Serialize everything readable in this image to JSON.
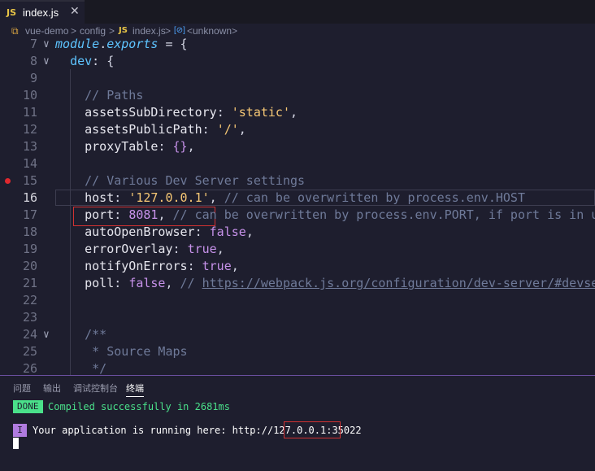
{
  "tab": {
    "icon": "JS",
    "filename": "index.js",
    "close": "✕"
  },
  "breadcrumb": {
    "c1": "vue-demo",
    "c2": "config",
    "c3_icon": "JS",
    "c3": "index.js",
    "c4_icon": "[⊘]",
    "c4": "<unknown>",
    "sep": ">"
  },
  "editor": {
    "lines": [
      {
        "num": "7",
        "fold": "∨",
        "code": [
          [
            "it",
            "module"
          ],
          [
            "p",
            "."
          ],
          [
            "it",
            "exports"
          ],
          [
            "p",
            " = {"
          ]
        ]
      },
      {
        "num": "8",
        "fold": "∨",
        "code": [
          [
            "p",
            "  "
          ],
          [
            "k",
            "dev"
          ],
          [
            "p",
            ": {"
          ]
        ]
      },
      {
        "num": "9",
        "code": []
      },
      {
        "num": "10",
        "code": [
          [
            "p",
            "    "
          ],
          [
            "c",
            "// Paths"
          ]
        ]
      },
      {
        "num": "11",
        "code": [
          [
            "p",
            "    "
          ],
          [
            "pr",
            "assetsSubDirectory"
          ],
          [
            "p",
            ": "
          ],
          [
            "s",
            "'static'"
          ],
          [
            "p",
            ","
          ]
        ]
      },
      {
        "num": "12",
        "code": [
          [
            "p",
            "    "
          ],
          [
            "pr",
            "assetsPublicPath"
          ],
          [
            "p",
            ": "
          ],
          [
            "s",
            "'/'"
          ],
          [
            "p",
            ","
          ]
        ]
      },
      {
        "num": "13",
        "code": [
          [
            "p",
            "    "
          ],
          [
            "pr",
            "proxyTable"
          ],
          [
            "p",
            ": "
          ],
          [
            "b",
            "{}"
          ],
          [
            "p",
            ","
          ]
        ]
      },
      {
        "num": "14",
        "code": []
      },
      {
        "num": "15",
        "code": [
          [
            "p",
            "    "
          ],
          [
            "c",
            "// Various Dev Server settings"
          ]
        ]
      },
      {
        "num": "16",
        "cur": true,
        "code": [
          [
            "p",
            "    "
          ],
          [
            "pr",
            "host"
          ],
          [
            "p",
            ": "
          ],
          [
            "s",
            "'127.0.0.1'"
          ],
          [
            "p",
            ", "
          ],
          [
            "c",
            "// can be overwritten by process.env.HOST"
          ]
        ]
      },
      {
        "num": "17",
        "code": [
          [
            "p",
            "    "
          ],
          [
            "pr",
            "port"
          ],
          [
            "p",
            ": "
          ],
          [
            "n",
            "8081"
          ],
          [
            "p",
            ", "
          ],
          [
            "c",
            "// can be overwritten by process.env.PORT, if port is in use"
          ]
        ]
      },
      {
        "num": "18",
        "code": [
          [
            "p",
            "    "
          ],
          [
            "pr",
            "autoOpenBrowser"
          ],
          [
            "p",
            ": "
          ],
          [
            "n",
            "false"
          ],
          [
            "p",
            ","
          ]
        ]
      },
      {
        "num": "19",
        "code": [
          [
            "p",
            "    "
          ],
          [
            "pr",
            "errorOverlay"
          ],
          [
            "p",
            ": "
          ],
          [
            "n",
            "true"
          ],
          [
            "p",
            ","
          ]
        ]
      },
      {
        "num": "20",
        "code": [
          [
            "p",
            "    "
          ],
          [
            "pr",
            "notifyOnErrors"
          ],
          [
            "p",
            ": "
          ],
          [
            "n",
            "true"
          ],
          [
            "p",
            ","
          ]
        ]
      },
      {
        "num": "21",
        "code": [
          [
            "p",
            "    "
          ],
          [
            "pr",
            "poll"
          ],
          [
            "p",
            ": "
          ],
          [
            "n",
            "false"
          ],
          [
            "p",
            ", "
          ],
          [
            "c",
            "// "
          ],
          [
            "u",
            "https://webpack.js.org/configuration/dev-server/#devserver"
          ]
        ]
      },
      {
        "num": "22",
        "code": []
      },
      {
        "num": "23",
        "code": []
      },
      {
        "num": "24",
        "fold": "∨",
        "code": [
          [
            "p",
            "    "
          ],
          [
            "c",
            "/**"
          ]
        ]
      },
      {
        "num": "25",
        "code": [
          [
            "p",
            "     "
          ],
          [
            "c",
            "* Source Maps"
          ]
        ]
      },
      {
        "num": "26",
        "code": [
          [
            "p",
            "     "
          ],
          [
            "c",
            "*/"
          ]
        ]
      }
    ]
  },
  "panel": {
    "tabs": [
      "问题",
      "输出",
      "调试控制台",
      "终端"
    ],
    "active_tab": "终端",
    "done_badge": "DONE",
    "compiled_msg": "Compiled successfully in 2681ms",
    "info_badge": "I",
    "running_msg": "Your application is running here: http://127.0.0.1:35022"
  },
  "colors": {
    "accent": "#6b4fa0",
    "success": "#4ae08a",
    "highlight_box": "#d23232",
    "breakpoint": "#e0282e"
  }
}
